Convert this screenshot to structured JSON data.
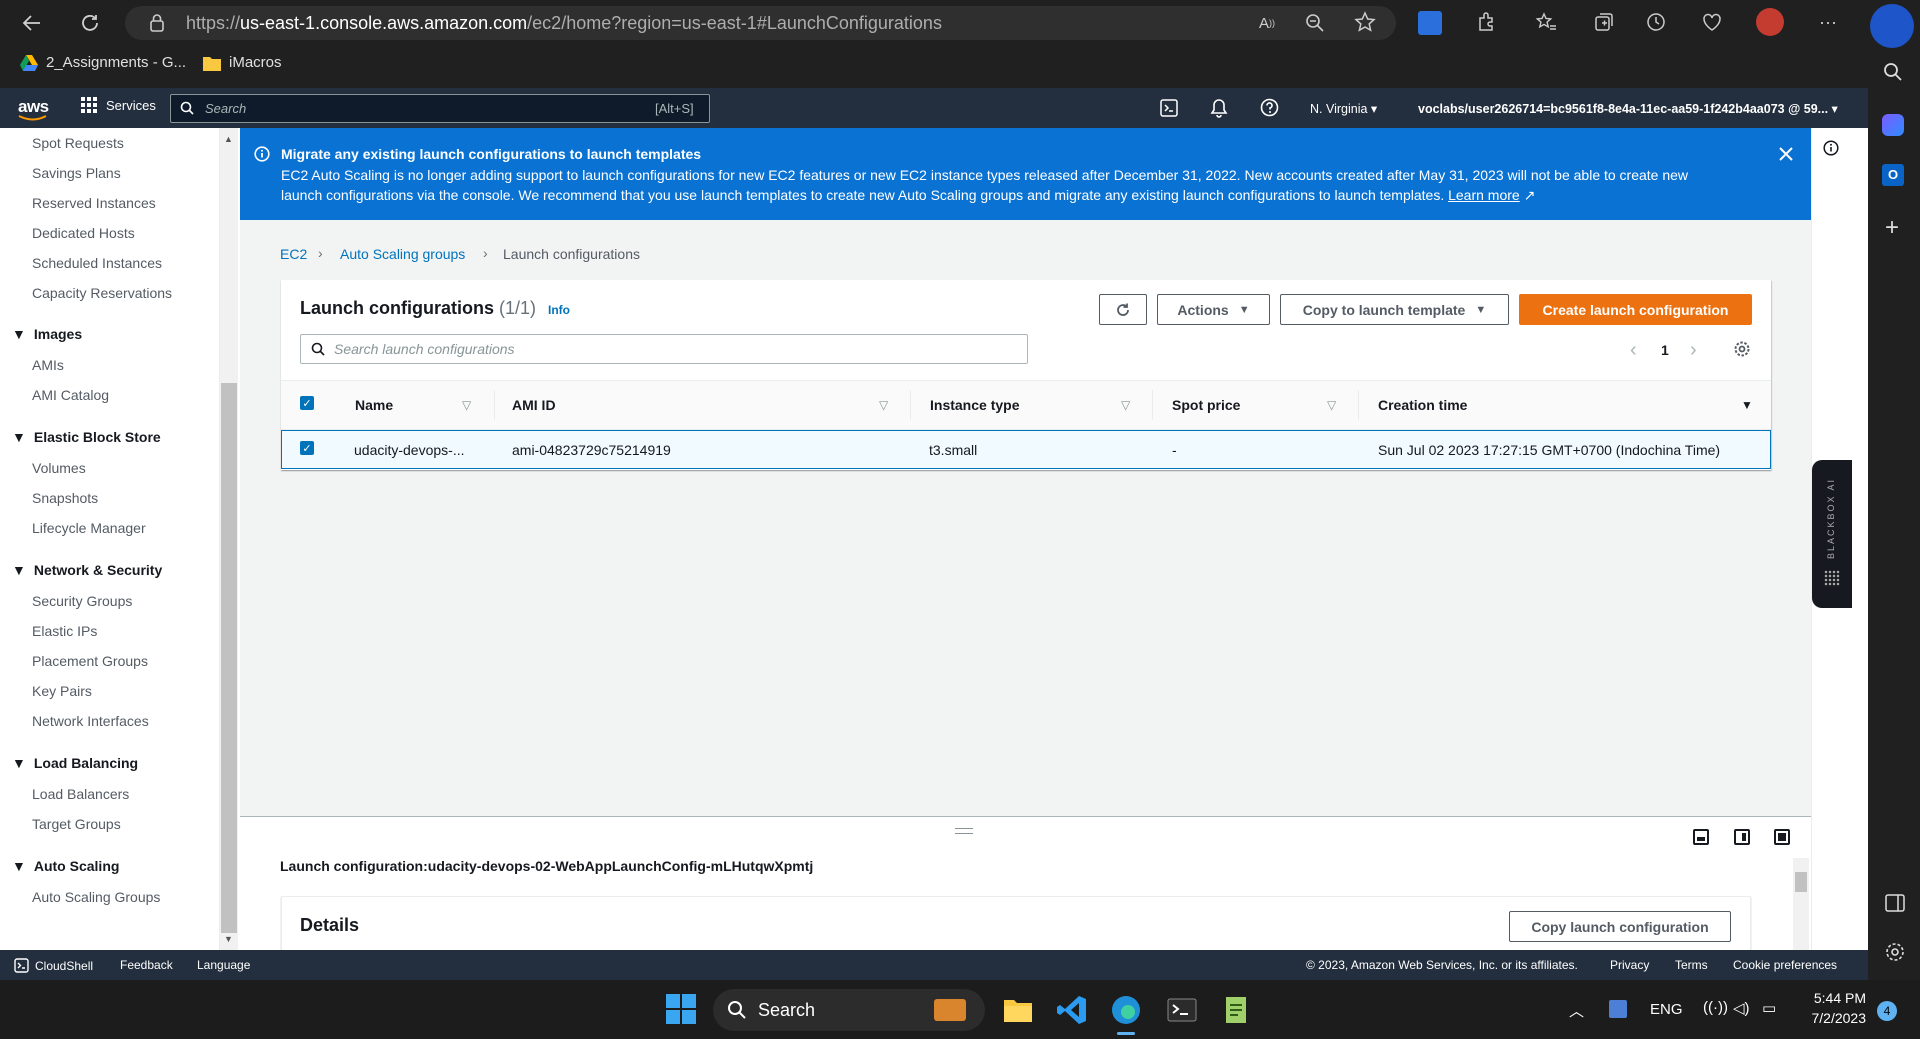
{
  "browser": {
    "url_prefix": "https://",
    "url_host": "us-east-1.console.aws.amazon.com",
    "url_path": "/ec2/home?region=us-east-1#LaunchConfigurations",
    "bookmarks": [
      "2_Assignments - G...",
      "iMacros"
    ]
  },
  "aws_nav": {
    "logo": "aws",
    "services": "Services",
    "search_placeholder": "Search",
    "search_shortcut": "[Alt+S]",
    "region": "N. Virginia",
    "account": "voclabs/user2626714=bc9561f8-8e4a-11ec-aa59-1f242b4aa073 @ 59..."
  },
  "sidebar": {
    "items_top": [
      "Spot Requests",
      "Savings Plans",
      "Reserved Instances",
      "Dedicated Hosts",
      "Scheduled Instances",
      "Capacity Reservations"
    ],
    "images": {
      "title": "Images",
      "items": [
        "AMIs",
        "AMI Catalog"
      ]
    },
    "ebs": {
      "title": "Elastic Block Store",
      "items": [
        "Volumes",
        "Snapshots",
        "Lifecycle Manager"
      ]
    },
    "network": {
      "title": "Network & Security",
      "items": [
        "Security Groups",
        "Elastic IPs",
        "Placement Groups",
        "Key Pairs",
        "Network Interfaces"
      ]
    },
    "lb": {
      "title": "Load Balancing",
      "items": [
        "Load Balancers",
        "Target Groups"
      ]
    },
    "as": {
      "title": "Auto Scaling",
      "items": [
        "Auto Scaling Groups"
      ]
    }
  },
  "banner": {
    "title": "Migrate any existing launch configurations to launch templates",
    "body": "EC2 Auto Scaling is no longer adding support to launch configurations for new EC2 features or new EC2 instance types released after December 31, 2022. New accounts created after May 31, 2023 will not be able to create new launch configurations via the console. We recommend that you use launch templates to create new Auto Scaling groups and migrate any existing launch configurations to launch templates.",
    "link": "Learn more"
  },
  "breadcrumb": [
    "EC2",
    "Auto Scaling groups",
    "Launch configurations"
  ],
  "panel": {
    "title": "Launch configurations",
    "count": "(1/1)",
    "info": "Info",
    "actions": "Actions",
    "copy_template": "Copy to launch template",
    "create": "Create launch configuration",
    "search_placeholder": "Search launch configurations",
    "page": "1"
  },
  "table": {
    "headers": [
      "Name",
      "AMI ID",
      "Instance type",
      "Spot price",
      "Creation time"
    ],
    "rows": [
      [
        "udacity-devops-...",
        "ami-04823729c75214919",
        "t3.small",
        "-",
        "Sun Jul 02 2023 17:27:15 GMT+0700 (Indochina Time)"
      ]
    ]
  },
  "split": {
    "title": "Launch configuration:udacity-devops-02-WebAppLaunchConfig-mLHutqwXpmtj",
    "details": "Details",
    "copy_btn": "Copy launch configuration"
  },
  "footer": {
    "cloudshell": "CloudShell",
    "feedback": "Feedback",
    "language": "Language",
    "copyright": "© 2023, Amazon Web Services, Inc. or its affiliates.",
    "privacy": "Privacy",
    "terms": "Terms",
    "cookies": "Cookie preferences"
  },
  "blackbox_label": "BLACKBOX AI",
  "taskbar": {
    "search": "Search",
    "lang": "ENG",
    "time": "5:44 PM",
    "date": "7/2/2023",
    "badge": "4"
  },
  "colors": {
    "aws_nav": "#232f3e",
    "banner": "#0972d3",
    "primary_button": "#ec7211",
    "link": "#0073bb"
  }
}
